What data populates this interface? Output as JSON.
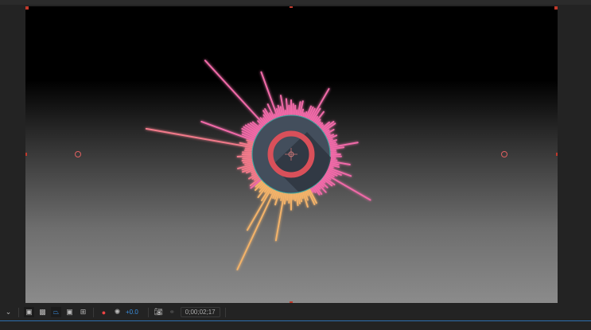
{
  "viewer": {
    "exposure": "+0.0",
    "timecode": "0;00;02;17"
  },
  "icons": [
    "chevron-down-icon",
    "region-of-interest-icon",
    "transparency-grid-icon",
    "mask-path-visibility-icon",
    "safe-margins-icon",
    "guides-icon",
    "color-channels-icon",
    "exposure-icon",
    "camera-snapshot-icon",
    "show-snapshot-icon"
  ],
  "colors": {
    "ring": "#d9505a",
    "disc": "#434e5c",
    "pink": "#f06aa8",
    "orange": "#f3b36a",
    "outline": "#3aa7a0"
  }
}
